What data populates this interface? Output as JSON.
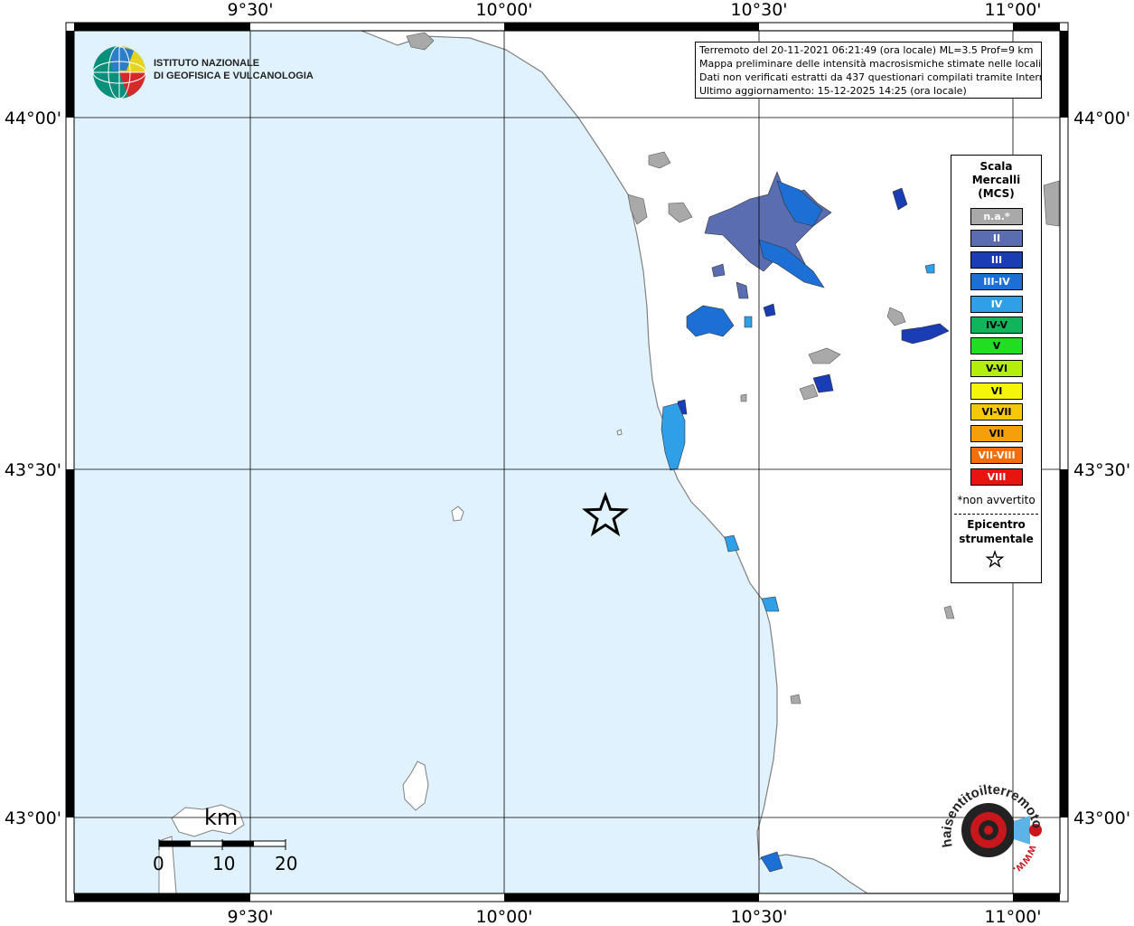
{
  "map": {
    "lon_labels": [
      "9°30'",
      "10°00'",
      "10°30'",
      "11°00'"
    ],
    "lat_labels": [
      "44°00'",
      "43°30'",
      "43°00'"
    ],
    "colors": {
      "sea": "#e0f2fd",
      "land": "#ffffff",
      "coast": "#808080",
      "not_felt": "#a9a9a9"
    }
  },
  "info": {
    "line1": "Terremoto del 20-11-2021 06:21:49 (ora locale) ML=3.5 Prof=9 km",
    "line2": "Mappa preliminare delle intensità macrosismiche stimate nelle località",
    "line3": "Dati non verificati estratti da 437 questionari compilati tramite Internet.",
    "line4": "Ultimo aggiornamento: 15-12-2025 14:25 (ora locale)"
  },
  "logo": {
    "line1": "ISTITUTO NAZIONALE",
    "line2": "DI GEOFISICA E VULCANOLOGIA"
  },
  "legend": {
    "title": "Scala\nMercalli\n(MCS)",
    "items": [
      {
        "label": "n.a.*",
        "color": "#a9a9a9"
      },
      {
        "label": "II",
        "color": "#5a6db0"
      },
      {
        "label": "III",
        "color": "#1a3cb4"
      },
      {
        "label": "III-IV",
        "color": "#1c6fd4"
      },
      {
        "label": "IV",
        "color": "#2f9fe8"
      },
      {
        "label": "IV-V",
        "color": "#10b45a"
      },
      {
        "label": "V",
        "color": "#22dd22"
      },
      {
        "label": "V-VI",
        "color": "#b4ee0c"
      },
      {
        "label": "VI",
        "color": "#f5f50a"
      },
      {
        "label": "VI-VII",
        "color": "#f5c80a"
      },
      {
        "label": "VII",
        "color": "#f5a00a"
      },
      {
        "label": "VII-VIII",
        "color": "#f56e0a"
      },
      {
        "label": "VIII",
        "color": "#e8140f"
      }
    ],
    "note": "*non avvertito",
    "epicenter_label": "Epicentro\nstrumentale"
  },
  "scalebar": {
    "unit": "km",
    "ticks": [
      "0",
      "10",
      "20"
    ]
  },
  "hsit_logo": {
    "text": "haisentitoilterremoto.it",
    "prefix": "www."
  }
}
